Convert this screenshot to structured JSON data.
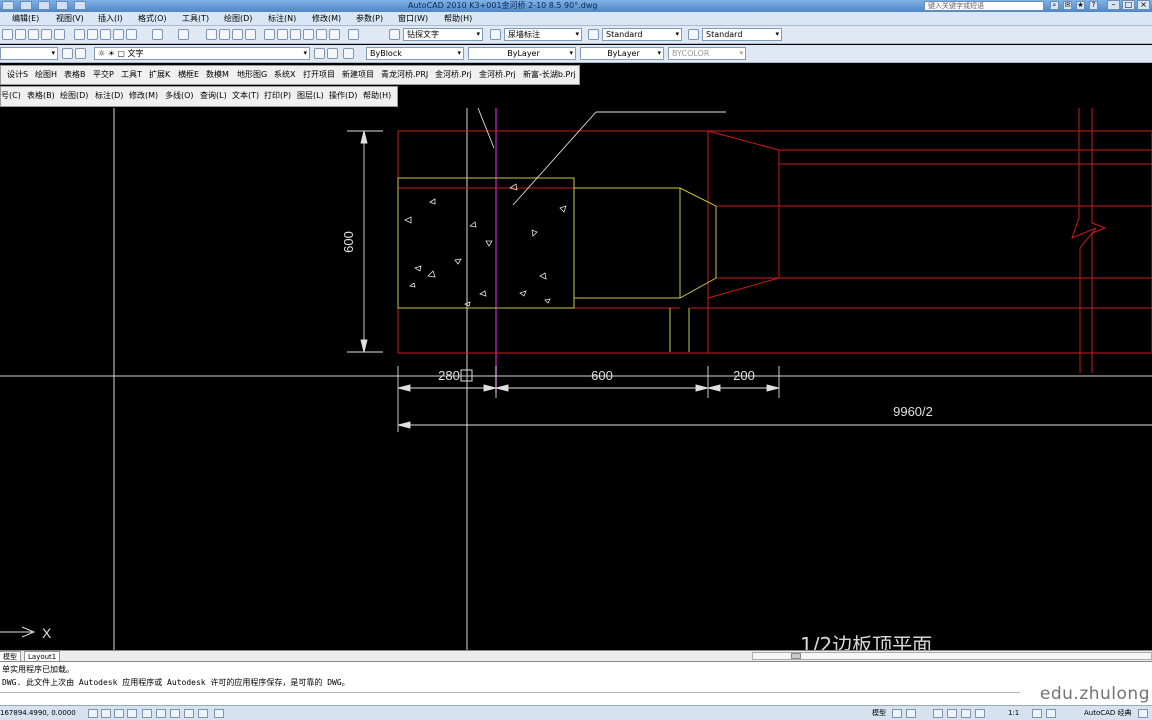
{
  "title_bar": {
    "title": "AutoCAD 2010    K3+001金河桥 2-10 8.5 90°.dwg",
    "search_placeholder": "键入关键字或短语"
  },
  "menu_bar": [
    "编辑(E)",
    "视图(V)",
    "插入(I)",
    "格式(O)",
    "工具(T)",
    "绘图(D)",
    "标注(N)",
    "修改(M)",
    "参数(P)",
    "窗口(W)",
    "帮助(H)"
  ],
  "styles_toolbar": {
    "text_style": "钻探文字",
    "dim_style": "尿墙标注",
    "table_style": "Standard",
    "multileader_style": "Standard"
  },
  "layers_toolbar": {
    "layer": "文字",
    "color": "ByBlock",
    "linetype": "ByLayer",
    "lineweight": "ByLayer",
    "plot_style": "BYCOLOR"
  },
  "custom_menu_1": [
    "设计S",
    "绘图H",
    "表格B",
    "平交P",
    "工具T",
    "扩展K",
    "横框E",
    "数模M",
    "地形图G",
    "系统X",
    "打开项目",
    "新建项目",
    "青龙河桥.PRJ",
    "金河桥.Prj",
    "金河桥.Prj",
    "新富-长湖b.Prj"
  ],
  "custom_menu_2": [
    "号(C)",
    "表格(B)",
    "绘图(D)",
    "标注(D)",
    "修改(M)",
    "多线(O)",
    "查询(L)",
    "文本(T)",
    "打印(P)",
    "图层(L)",
    "操作(D)",
    "帮助(H)"
  ],
  "drawing": {
    "dim_vertical": "600",
    "dim_1": "280",
    "dim_2": "600",
    "dim_3": "200",
    "dim_overall": "9960/2",
    "caption": "1/2边板顶平面",
    "axis_label": "X"
  },
  "layout_tabs": [
    "模型",
    "Layout1"
  ],
  "command_lines": [
    "单实用程序已加载。",
    "DWG.   此文件上次由 Autodesk 应用程序或 Autodesk 许可的应用程序保存，是可靠的 DWG。"
  ],
  "status_bar": {
    "coordinates": "167894.4990, 0.0000",
    "model_label": "模型",
    "scale": "1:1",
    "workspace": "AutoCAD 经典"
  },
  "watermark": "edu.zhulong",
  "colors": {
    "canvas": "#000000",
    "red_lines": "#cc1b1b",
    "yellow_lines": "#c8c84a",
    "white_lines": "#e8e8e8",
    "magenta_line": "#c020c0"
  }
}
